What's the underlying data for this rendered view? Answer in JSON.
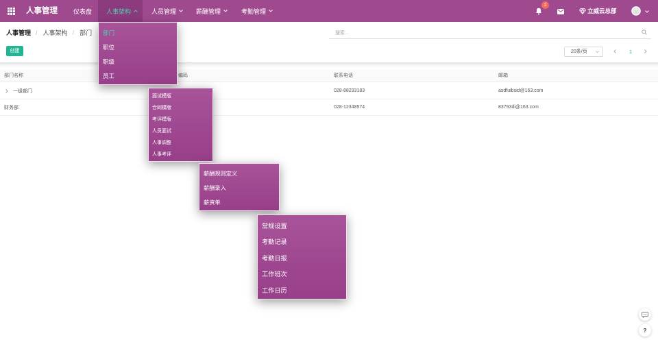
{
  "app": {
    "title": "人事管理"
  },
  "nav": {
    "items": [
      {
        "label": "仪表盘"
      },
      {
        "label": "人事架构",
        "active": true,
        "caret_icon": "chevron-up-icon"
      },
      {
        "label": "人员管理",
        "caret_icon": "chevron-down-icon"
      },
      {
        "label": "薪酬管理",
        "caret_icon": "chevron-down-icon"
      },
      {
        "label": "考勤管理",
        "caret_icon": "chevron-down-icon"
      }
    ]
  },
  "header": {
    "notification_count": "2",
    "company": "立威云总部"
  },
  "icons": {
    "apps": "apps-grid-icon",
    "notifications": "bell-icon",
    "messages": "envelope-icon",
    "company": "diamond-icon",
    "avatar": "avatar-icon",
    "search": "search-icon",
    "chat": "chat-icon",
    "expand": "chevron-right-icon"
  },
  "breadcrumb": {
    "items": [
      "人事管理",
      "人事架构",
      "部门"
    ],
    "separator": "/"
  },
  "search": {
    "placeholder": "搜索..."
  },
  "toolbar": {
    "create_label": "创建",
    "page_size": "20条/页",
    "current_page": "1"
  },
  "table": {
    "columns": [
      "部门名称",
      "编码",
      "联系电话",
      "邮箱"
    ],
    "rows": [
      {
        "name": "一级部门",
        "phone": "028-88293183",
        "email": "asdfuibsid@163.com",
        "expandable": true
      },
      {
        "name": "财务部",
        "phone": "028-12348574",
        "email": "83793di@163.com",
        "expandable": false
      }
    ]
  },
  "menus": {
    "org": {
      "items": [
        "部门",
        "职位",
        "职级",
        "员工"
      ],
      "active_index": 0
    },
    "personnel": {
      "items": [
        "面试模版",
        "合同模版",
        "考评模版",
        "人员面试",
        "人事调整",
        "人事考评"
      ]
    },
    "salary": {
      "items": [
        "薪酬规则定义",
        "薪酬录入",
        "薪资单"
      ]
    },
    "attendance": {
      "items": [
        "常规设置",
        "考勤记录",
        "考勤日报",
        "工作班次",
        "工作日历"
      ]
    }
  },
  "float_buttons": {
    "help": "?"
  },
  "colors": {
    "navbar": "#9f4a8f",
    "nav_active_bg": "#8b3a7e",
    "accent": "#22b494",
    "active_text": "#52cca9",
    "badge": "#f26b5b",
    "menu_top": "#a8539a",
    "menu_bottom": "#973f89"
  }
}
